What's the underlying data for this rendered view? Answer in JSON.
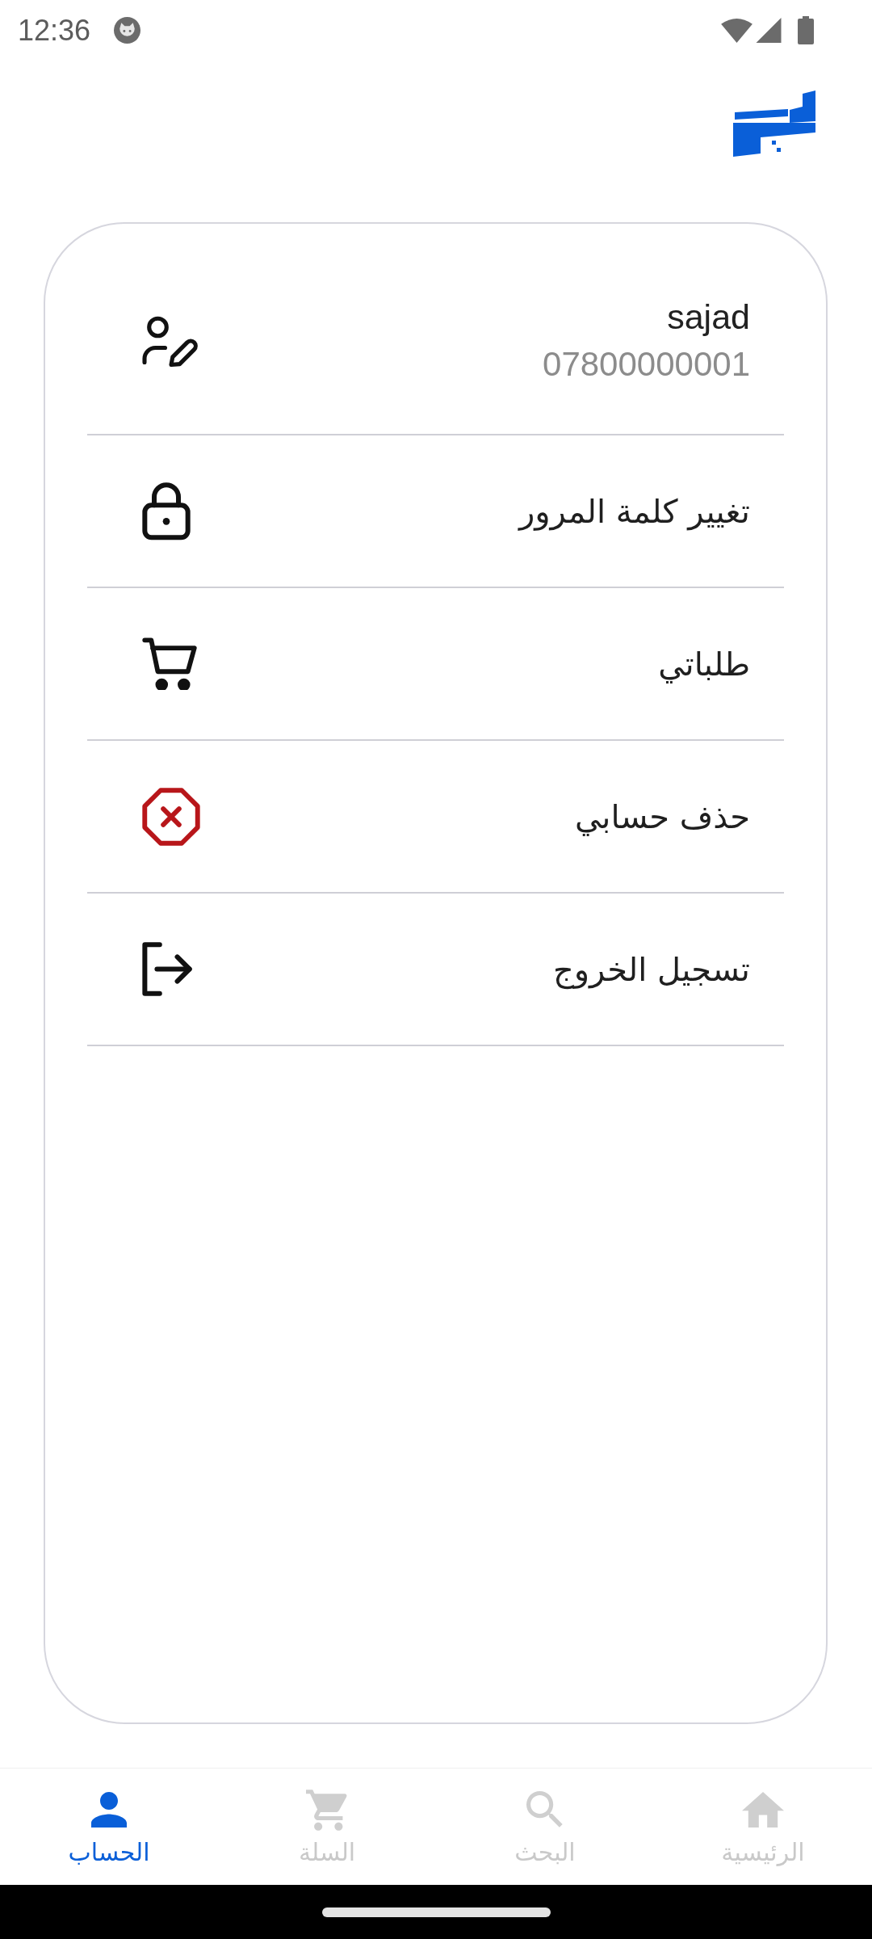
{
  "status_bar": {
    "time": "12:36"
  },
  "profile": {
    "name": "sajad",
    "phone": "07800000001"
  },
  "menu": [
    {
      "kind": "password",
      "label": "تغيير كلمة المرور"
    },
    {
      "kind": "orders",
      "label": "طلباتي"
    },
    {
      "kind": "delete",
      "label": "حذف حسابي"
    },
    {
      "kind": "logout",
      "label": "تسجيل الخروج"
    }
  ],
  "bottom_nav": [
    {
      "kind": "home",
      "label": "الرئيسية",
      "selected": false
    },
    {
      "kind": "search",
      "label": "البحث",
      "selected": false
    },
    {
      "kind": "cart",
      "label": "السلة",
      "selected": false
    },
    {
      "kind": "account",
      "label": "الحساب",
      "selected": true
    }
  ]
}
